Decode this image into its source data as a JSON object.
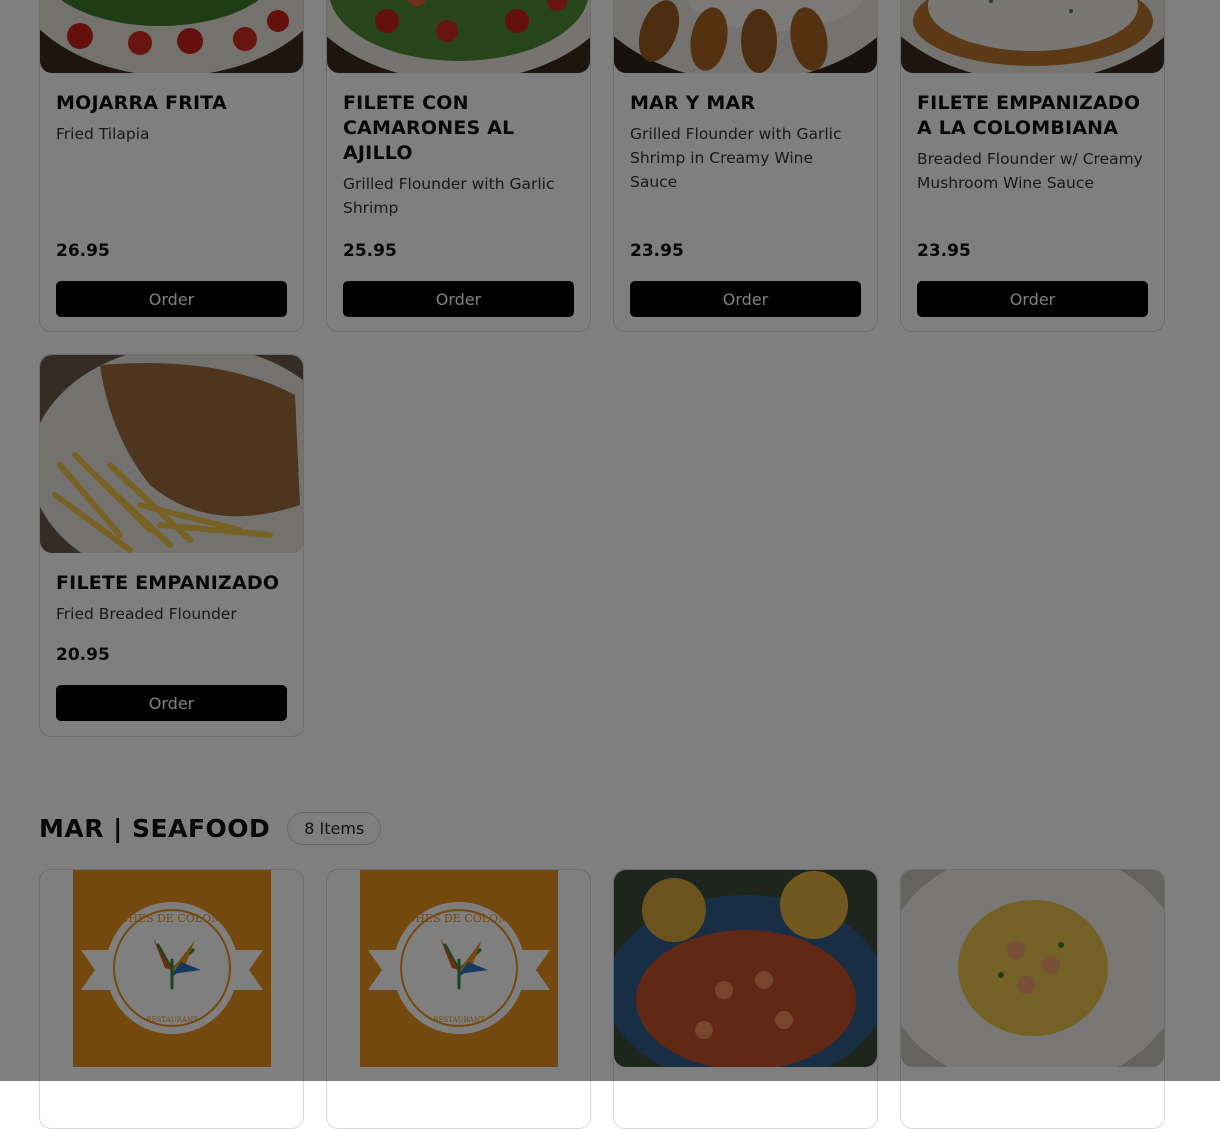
{
  "top_items": [
    {
      "name": "MOJARRA FRITA",
      "description": "Fried Tilapia",
      "price": "26.95",
      "order_label": "Order"
    },
    {
      "name": "FILETE CON CAMARONES AL AJILLO",
      "description": "Grilled Flounder with Garlic Shrimp",
      "price": "25.95",
      "order_label": "Order"
    },
    {
      "name": "MAR Y MAR",
      "description": "Grilled Flounder with Garlic Shrimp in Creamy Wine Sauce",
      "price": "23.95",
      "order_label": "Order"
    },
    {
      "name": "FILETE EMPANIZADO A LA COLOMBIANA",
      "description": "Breaded Flounder w/ Creamy Mushroom Wine Sauce",
      "price": "23.95",
      "order_label": "Order"
    },
    {
      "name": "FILETE EMPANIZADO",
      "description": "Fried Breaded Flounder",
      "price": "20.95",
      "order_label": "Order"
    }
  ],
  "seafood_section": {
    "title": "MAR | SEAFOOD",
    "count": "8 Items"
  },
  "logo": {
    "top_text": "NOCHES DE COLOMBIA",
    "bottom_text": "RESTAURANT",
    "bg_color": "#e8931f"
  },
  "overlay_color": "rgba(0,0,0,0.5)"
}
